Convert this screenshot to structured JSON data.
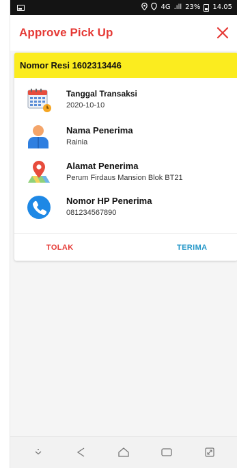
{
  "status_bar": {
    "network": "4G",
    "signal": ".ıll",
    "battery": "23%",
    "time": "14.05"
  },
  "app_bar": {
    "title": "Approve Pick Up",
    "close_icon": "close-icon"
  },
  "card": {
    "header": "Nomor Resi 1602313446",
    "rows": [
      {
        "icon": "calendar-icon",
        "label": "Tanggal Transaksi",
        "value": "2020-10-10"
      },
      {
        "icon": "person-icon",
        "label": "Nama Penerima",
        "value": "Rainia"
      },
      {
        "icon": "location-pin-icon",
        "label": "Alamat Penerima",
        "value": "Perum Firdaus Mansion Blok BT21"
      },
      {
        "icon": "phone-icon",
        "label": "Nomor HP Penerima",
        "value": "081234567890"
      }
    ],
    "actions": {
      "reject": "TOLAK",
      "accept": "TERIMA"
    }
  },
  "colors": {
    "accent_red": "#e53935",
    "header_yellow": "#fbec1f",
    "accept_blue": "#2196c8"
  },
  "nav_bar": [
    "chevron-down-icon",
    "back-icon",
    "home-icon",
    "recents-icon",
    "expand-icon"
  ]
}
